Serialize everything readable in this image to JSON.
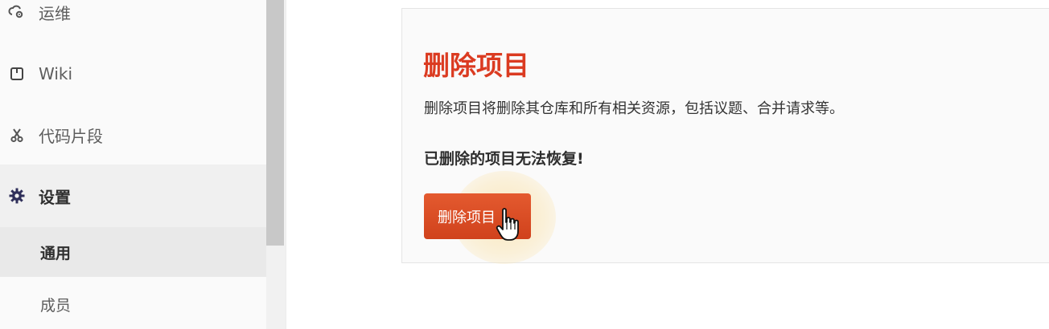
{
  "sidebar": {
    "items": [
      {
        "label": "运维",
        "icon": "cloud-gear-icon"
      },
      {
        "label": "Wiki",
        "icon": "book-icon"
      },
      {
        "label": "代码片段",
        "icon": "scissors-icon"
      },
      {
        "label": "设置",
        "icon": "gear-icon",
        "active": true
      }
    ],
    "subitems": [
      {
        "label": "通用",
        "active": true
      },
      {
        "label": "成员",
        "active": false
      }
    ]
  },
  "panel": {
    "title": "删除项目",
    "description": "删除项目将删除其仓库和所有相关资源，包括议题、合并请求等。",
    "warning": "已删除的项目无法恢复!",
    "button_label": "删除项目"
  },
  "colors": {
    "danger": "#db3b21",
    "button": "#d9471f",
    "active_bg": "#e9e9e9"
  }
}
